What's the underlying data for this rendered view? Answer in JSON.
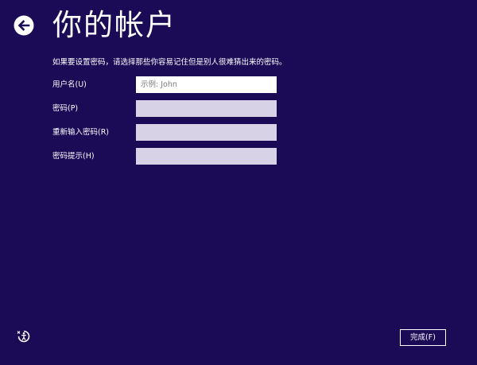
{
  "header": {
    "back_icon": "back-arrow-icon",
    "title": "你的帐户"
  },
  "instructions": "如果要设置密码，请选择那些你容易记住但是别人很难猜出来的密码。",
  "form": {
    "username": {
      "label": "用户名(U)",
      "value": "",
      "placeholder": "示例: John"
    },
    "password": {
      "label": "密码(P)",
      "value": "",
      "placeholder": ""
    },
    "confirm_password": {
      "label": "重新输入密码(R)",
      "value": "",
      "placeholder": ""
    },
    "password_hint": {
      "label": "密码提示(H)",
      "value": "",
      "placeholder": ""
    }
  },
  "footer": {
    "ease_of_access_icon": "ease-of-access-icon",
    "finish_label": "完成(F)"
  },
  "colors": {
    "background": "#1b0a56",
    "text": "#ffffff",
    "input_active": "#ffffff",
    "input_disabled": "#d8d2e6"
  }
}
